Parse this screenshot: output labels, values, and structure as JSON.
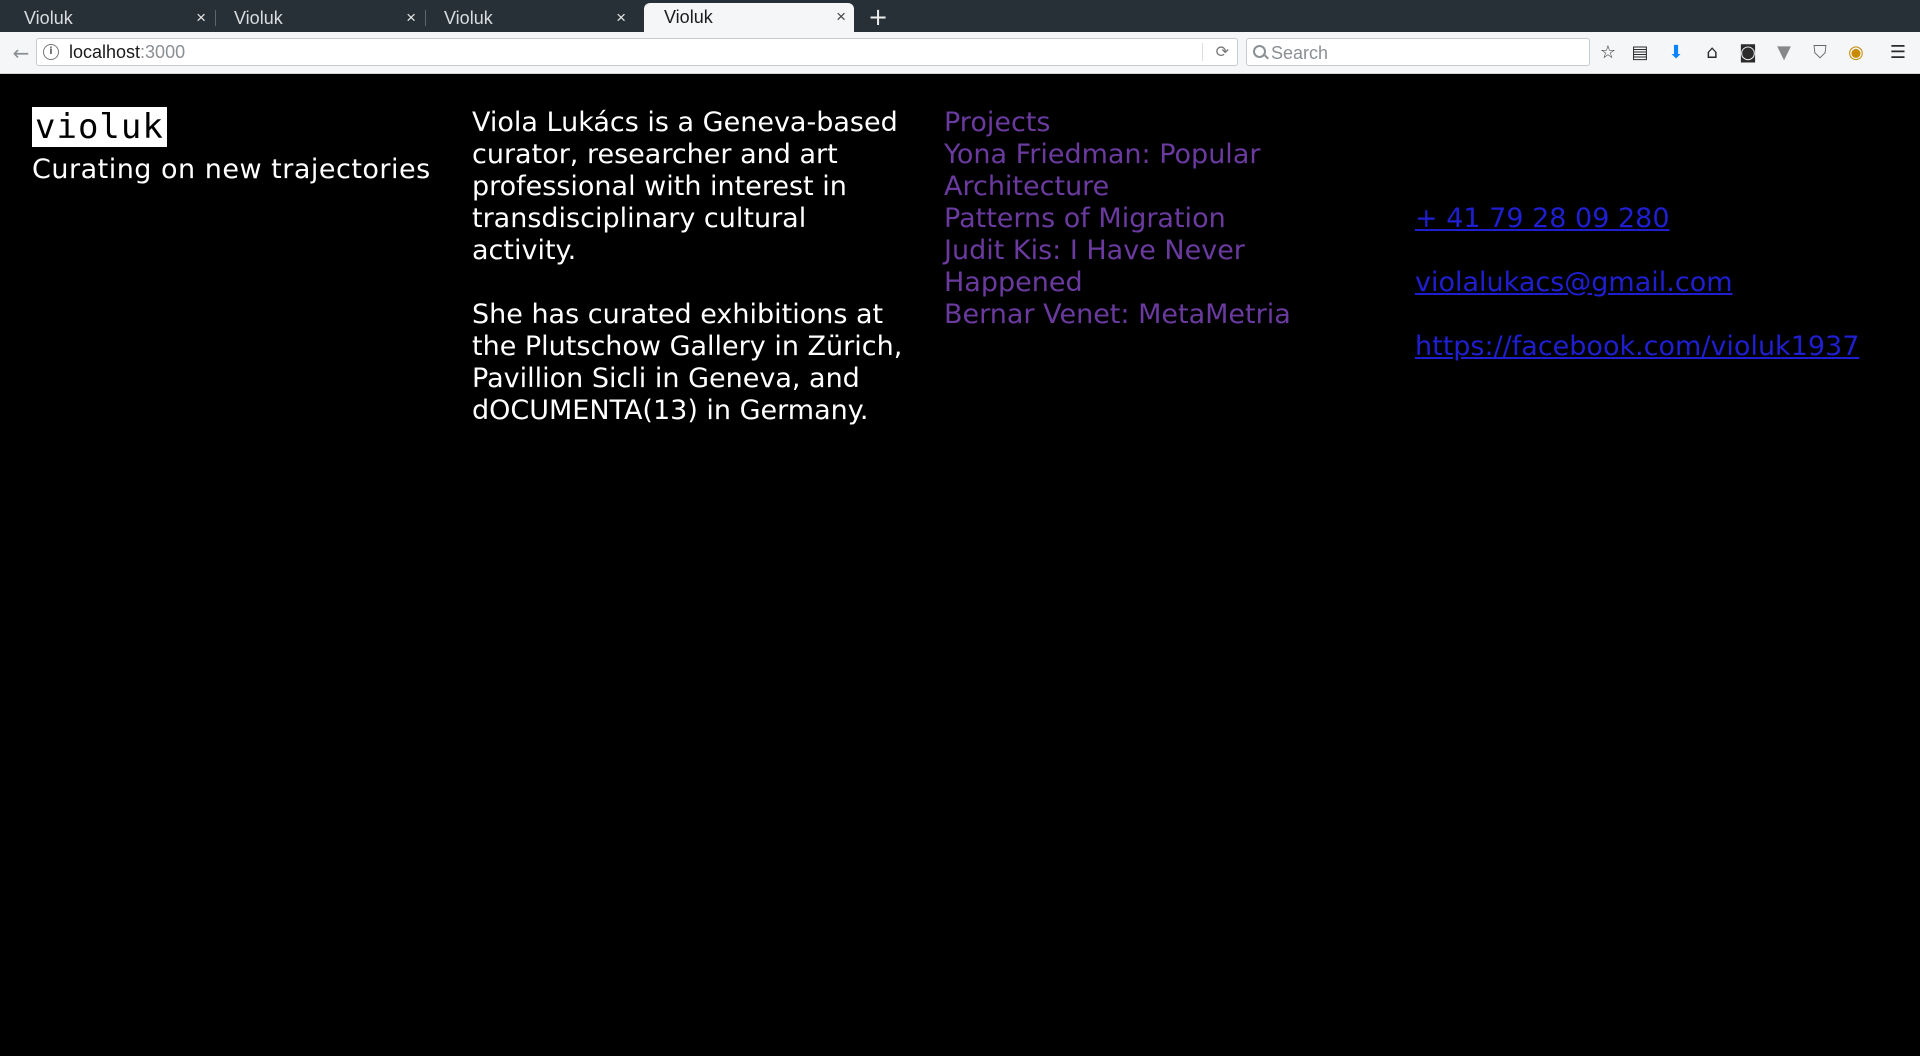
{
  "browser": {
    "tabs": [
      {
        "title": "Violuk",
        "close": "×"
      },
      {
        "title": "Violuk",
        "close": "×"
      },
      {
        "title": "Violuk",
        "close": "×"
      },
      {
        "title": "Violuk",
        "close": "×"
      }
    ],
    "new_tab": "+",
    "url": {
      "host": "localhost",
      "port": ":3000"
    },
    "search_placeholder": "Search",
    "toolbar_icons": [
      "bookmark-star-icon",
      "reading-list-icon",
      "download-icon",
      "home-icon",
      "pocket-icon",
      "extension-icon",
      "shield-icon",
      "color-picker-icon",
      "menu-icon"
    ]
  },
  "site": {
    "logo": "violuk",
    "tagline": "Curating on new trajectories",
    "bio": [
      "Viola Lukács is a Geneva-based curator, researcher and art professional with interest in transdisciplinary cultural activity.",
      "She has curated exhibitions at the Plutschow Gallery in Zürich, Pavillion Sicli in Geneva, and dOCUMENTA(13) in Germany."
    ],
    "projects": {
      "heading": "Projects",
      "items": [
        "Yona Friedman: Popular Architecture",
        "Patterns of Migration",
        "Judit Kis: I Have Never Happened",
        "Bernar Venet: MetaMetria"
      ]
    },
    "contact": {
      "phone": "+ 41 79 28 09 280",
      "email": "violalukacs@gmail.com",
      "facebook": "https://facebook.com/violuk1937"
    },
    "colors": {
      "background": "#000000",
      "projects": "#6a3a9f",
      "links": "#1f1fd1"
    }
  }
}
